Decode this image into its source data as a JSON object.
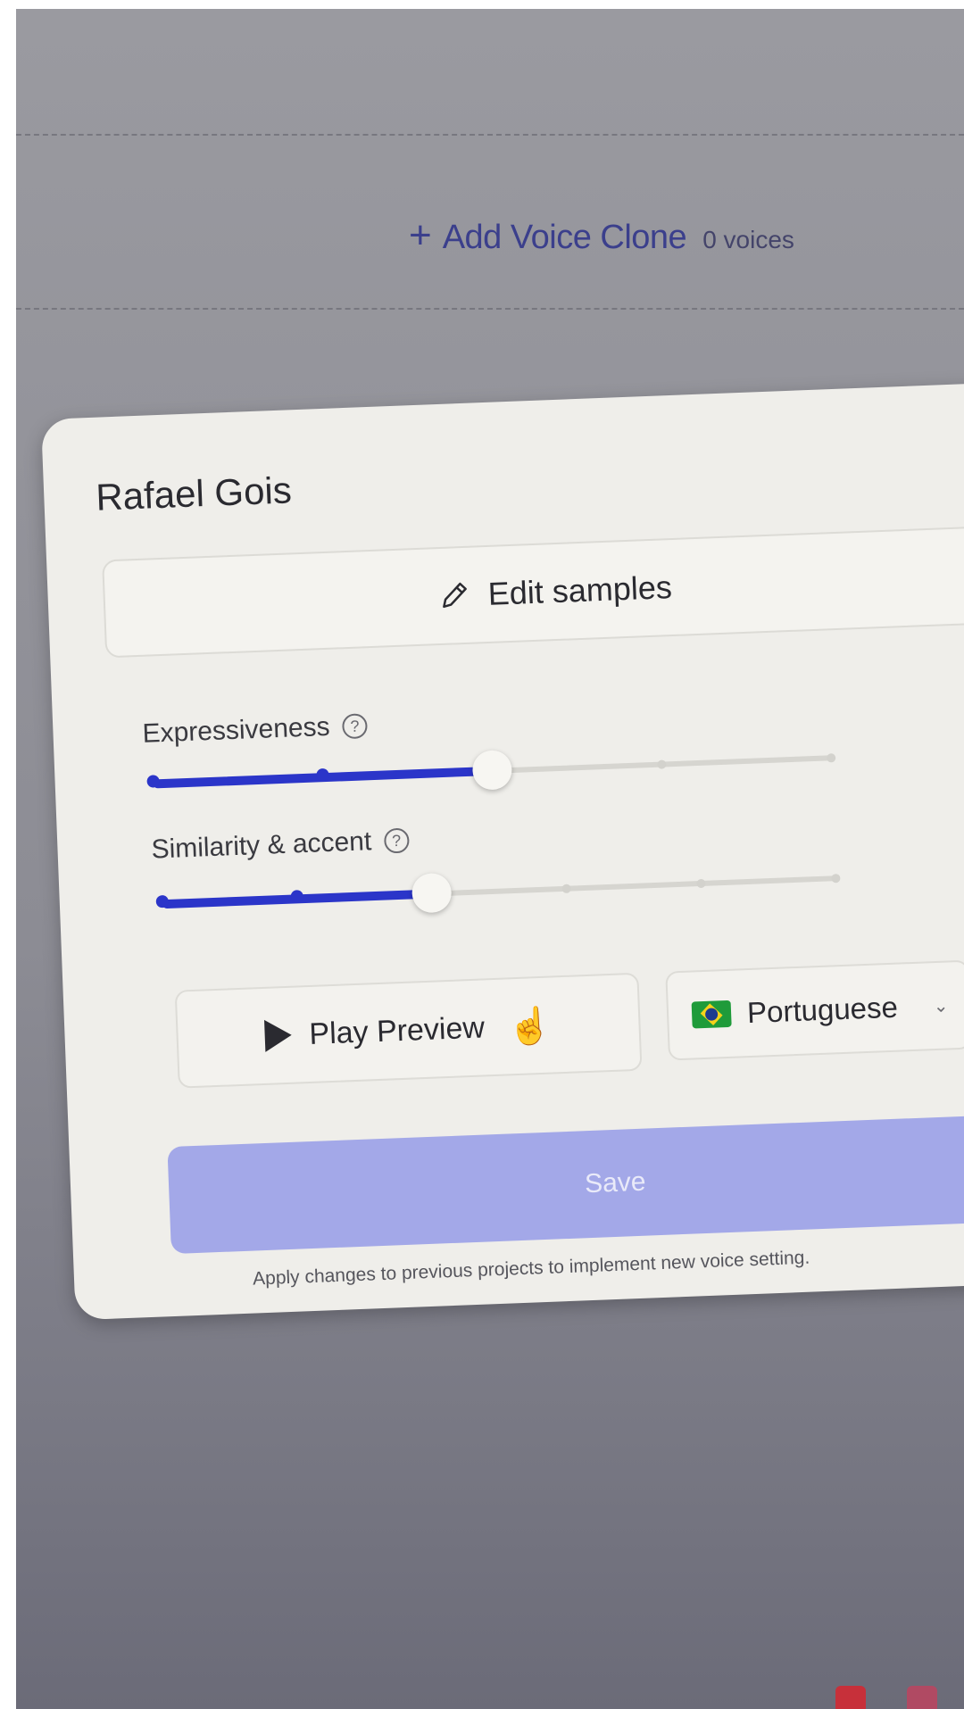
{
  "background": {
    "add_voice_clone_label": "Add Voice Clone",
    "voices_count": "0 voices",
    "plus_icon": "plus-icon"
  },
  "modal": {
    "title": "Rafael Gois",
    "edit_samples_label": "Edit samples",
    "expressiveness": {
      "label": "Expressiveness",
      "value": 0.5
    },
    "similarity": {
      "label": "Similarity & accent",
      "value": 0.4
    },
    "play_preview_label": "Play Preview",
    "language": {
      "selected": "Portuguese",
      "flag_icon": "brazil-flag-icon"
    },
    "save_label": "Save",
    "note": "Apply changes to previous projects to implement new voice setting."
  },
  "colors": {
    "accent": "#2b35c9",
    "save_button": "#a3a8e8",
    "add_link": "#3b3f8c",
    "card_bg": "#efeeea"
  }
}
